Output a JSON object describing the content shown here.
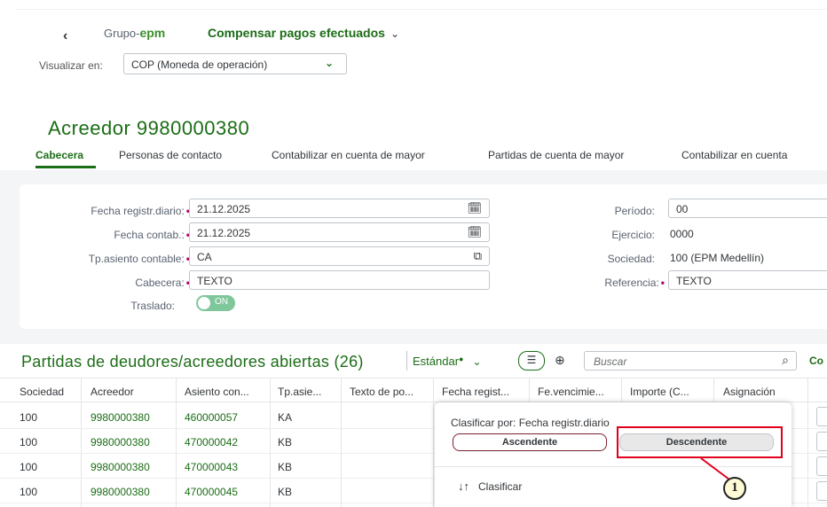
{
  "header": {
    "back_label": "‹",
    "logo_prefix": "Grupo-",
    "logo_brand": "epm",
    "app_title": "Compensar pagos efectuados",
    "app_title_chevron": "⌄",
    "view_label": "Visualizar en:",
    "view_value": "COP (Moneda de operación)"
  },
  "object": {
    "title": "Acreedor 9980000380",
    "tabs": [
      {
        "label": "Cabecera",
        "active": true
      },
      {
        "label": "Personas de contacto",
        "active": false
      },
      {
        "label": "Contabilizar en cuenta de mayor",
        "active": false
      },
      {
        "label": "Partidas de cuenta de mayor",
        "active": false
      },
      {
        "label": "Contabilizar en cuenta",
        "active": false
      }
    ]
  },
  "form": {
    "left": [
      {
        "label": "Fecha registr.diario:",
        "value": "21.12.2025",
        "required": true,
        "icon": "calendar-icon"
      },
      {
        "label": "Fecha contab.:",
        "value": "21.12.2025",
        "required": true,
        "icon": "calendar-icon"
      },
      {
        "label": "Tp.asiento contable:",
        "value": "CA",
        "required": true,
        "icon": "value-help-icon"
      },
      {
        "label": "Cabecera:",
        "value": "TEXTO",
        "required": true,
        "icon": ""
      }
    ],
    "traslado": {
      "label": "Traslado:",
      "value": "ON"
    },
    "right": [
      {
        "label": "Período:",
        "value": "00",
        "required": false,
        "editable": true
      },
      {
        "label": "Ejercicio:",
        "value": "0000",
        "required": false,
        "editable": false
      },
      {
        "label": "Sociedad:",
        "value": "100 (EPM Medellín)",
        "required": false,
        "editable": false
      },
      {
        "label": "Referencia:",
        "value": "TEXTO",
        "required": true,
        "editable": true
      }
    ]
  },
  "table": {
    "title": "Partidas de deudores/acreedores abiertas (26)",
    "variant": "Estándar",
    "search_placeholder": "Buscar",
    "toolbar_cut_label": "Co",
    "columns": [
      "Sociedad",
      "Acreedor",
      "Asiento con...",
      "Tp.asie...",
      "Texto de po...",
      "Fecha regist...",
      "Fe.vencimie...",
      "Importe (C...",
      "Asignación"
    ],
    "rows": [
      [
        "100",
        "9980000380",
        "460000057",
        "KA"
      ],
      [
        "100",
        "9980000380",
        "470000042",
        "KB"
      ],
      [
        "100",
        "9980000380",
        "470000043",
        "KB"
      ],
      [
        "100",
        "9980000380",
        "470000045",
        "KB"
      ]
    ]
  },
  "popover": {
    "title": "Clasificar por: Fecha registr.diario",
    "ascending_label": "Ascendente",
    "descending_label": "Descendente",
    "sort_label": "Clasificar",
    "sort_icon": "↓↑"
  },
  "annotation": {
    "number": "1",
    "highlight_color": "#e0001b"
  },
  "colors": {
    "brand_green": "#1b6d16",
    "required_marker": "#b0006d",
    "toggle_on": "#7fc79b"
  }
}
